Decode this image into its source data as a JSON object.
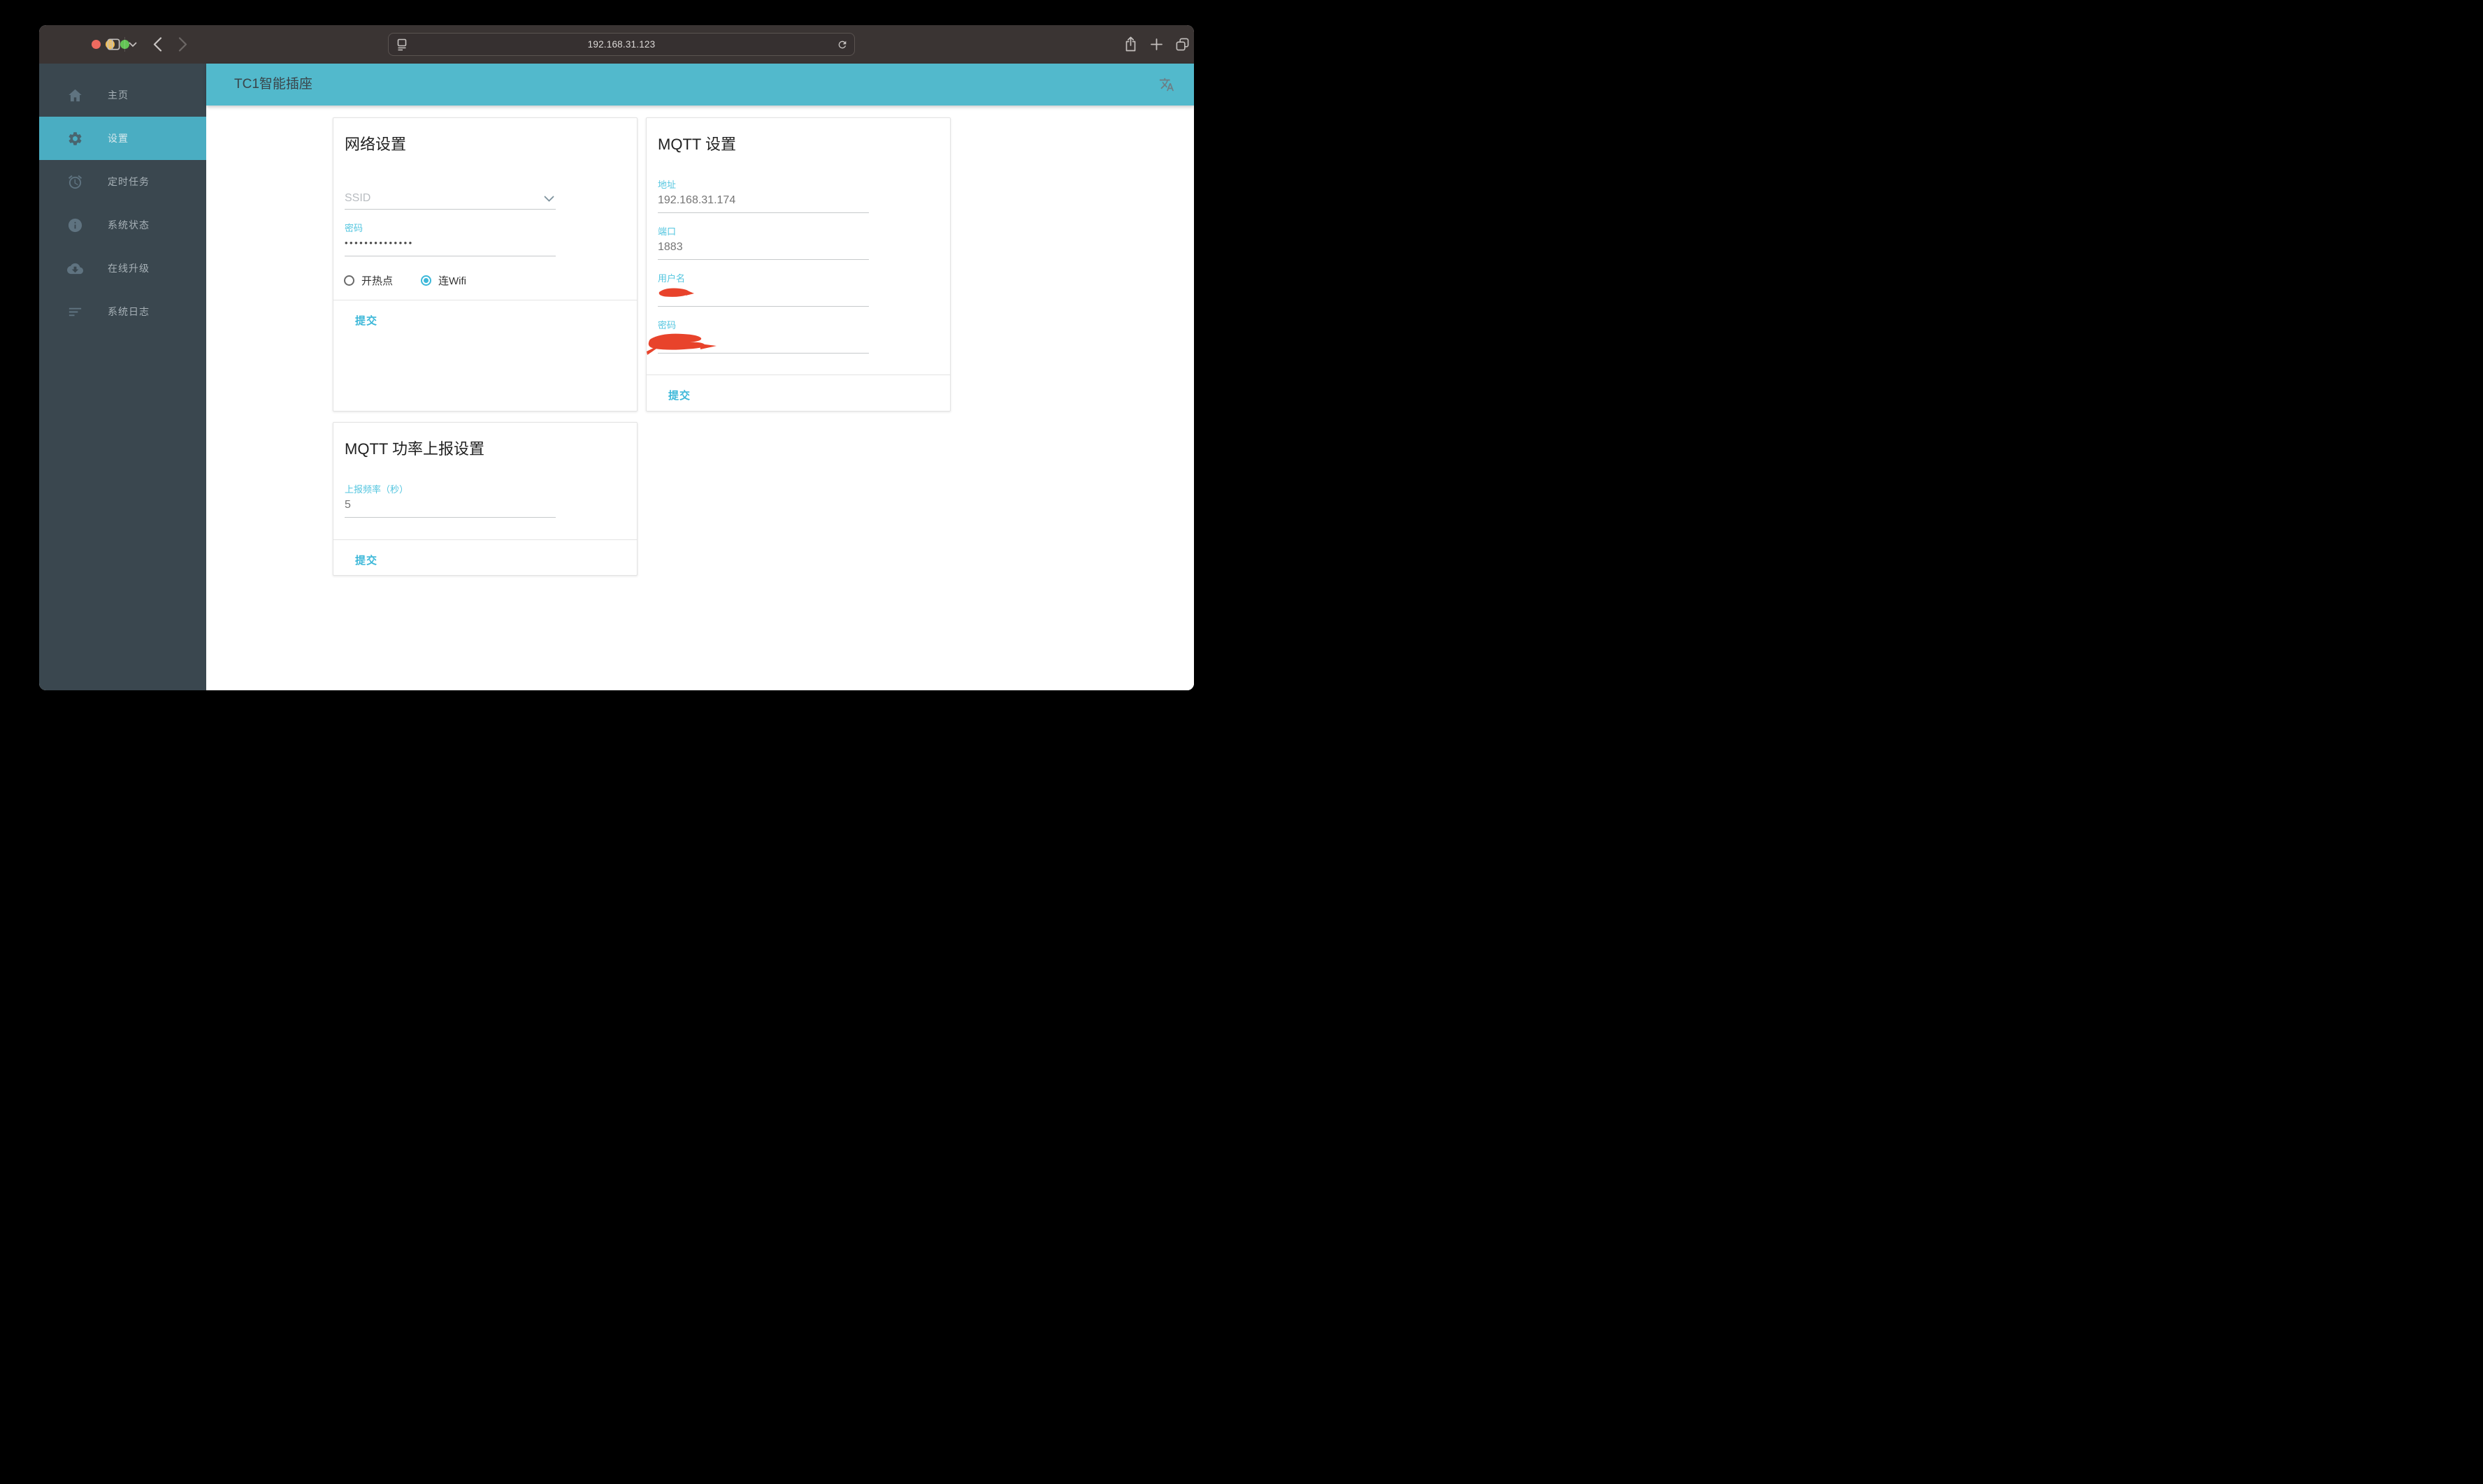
{
  "browser": {
    "url": "192.168.31.123"
  },
  "app": {
    "header_title": "TC1智能插座",
    "sidebar": {
      "items": [
        {
          "label": "主页",
          "icon": "home-icon",
          "active": false
        },
        {
          "label": "设置",
          "icon": "gear-icon",
          "active": true
        },
        {
          "label": "定时任务",
          "icon": "alarm-icon",
          "active": false
        },
        {
          "label": "系统状态",
          "icon": "info-icon",
          "active": false
        },
        {
          "label": "在线升级",
          "icon": "cloud-download-icon",
          "active": false
        },
        {
          "label": "系统日志",
          "icon": "log-icon",
          "active": false
        }
      ]
    }
  },
  "cards": {
    "network": {
      "title": "网络设置",
      "ssid_placeholder": "SSID",
      "password_label": "密码",
      "password_value": "••••••••••••••",
      "radios": [
        {
          "label": "开热点",
          "selected": false
        },
        {
          "label": "连Wifi",
          "selected": true
        }
      ],
      "submit_label": "提交"
    },
    "mqtt": {
      "title": "MQTT 设置",
      "address_label": "地址",
      "address_value": "192.168.31.174",
      "port_label": "端口",
      "port_value": "1883",
      "username_label": "用户名",
      "username_value": "",
      "password_label": "密码",
      "password_value": "",
      "submit_label": "提交"
    },
    "power": {
      "title": "MQTT 功率上报设置",
      "frequency_label": "上报频率（秒）",
      "frequency_value": "5",
      "submit_label": "提交"
    }
  },
  "colors": {
    "header_teal": "#52b9cc",
    "sidebar_bg": "#3a474f",
    "sidebar_active": "#4aadc2",
    "accent": "#3db8d9",
    "field_label": "#52c5df",
    "redaction_red": "#e8432b",
    "toolbar_bg": "#3a3433"
  },
  "icons": [
    "home-icon",
    "gear-icon",
    "alarm-icon",
    "info-icon",
    "cloud-download-icon",
    "log-icon",
    "translate-icon",
    "sidebar-toggle-icon",
    "chevron-down-icon",
    "back-icon",
    "forward-icon",
    "page-settings-icon",
    "reload-icon",
    "share-icon",
    "new-tab-icon",
    "tabs-overview-icon",
    "select-chevron-icon"
  ]
}
